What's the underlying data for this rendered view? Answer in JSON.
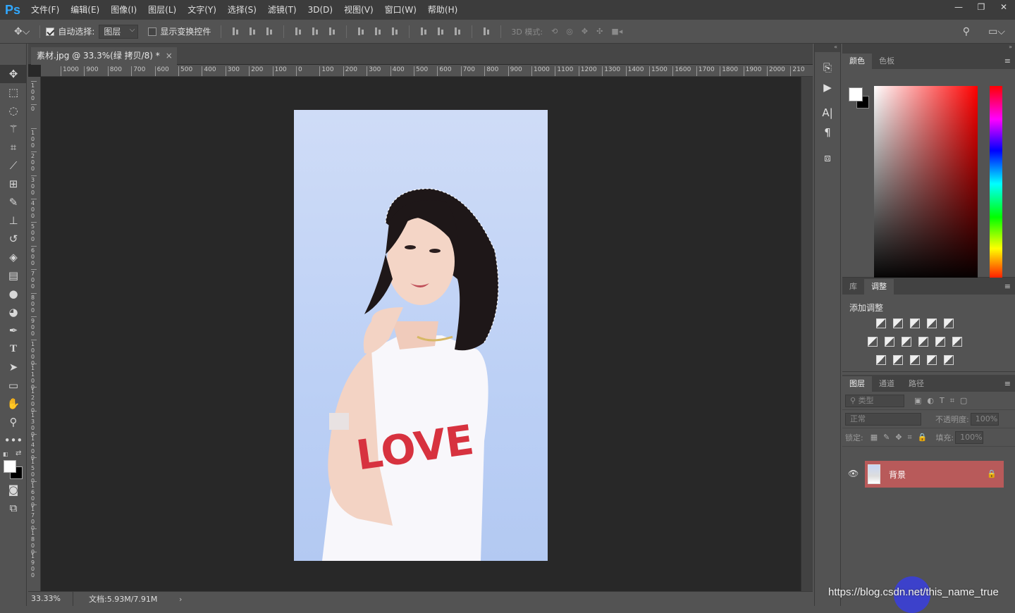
{
  "app": {
    "logo": "Ps"
  },
  "menu": [
    "文件(F)",
    "编辑(E)",
    "图像(I)",
    "图层(L)",
    "文字(Y)",
    "选择(S)",
    "滤镜(T)",
    "3D(D)",
    "视图(V)",
    "窗口(W)",
    "帮助(H)"
  ],
  "window_controls": [
    "—",
    "❐",
    "✕"
  ],
  "options": {
    "auto_select_label": "自动选择:",
    "auto_select_checked": true,
    "auto_select_value": "图层",
    "show_transform_label": "显示变换控件",
    "show_transform_checked": false,
    "mode_3d_label": "3D 模式:"
  },
  "document": {
    "tab_title": "素材.jpg @ 33.3%(绿 拷贝/8) *",
    "close": "×",
    "zoom": "33.33%",
    "doc_info": "文档:5.93M/7.91M",
    "ruler_h": [
      "1000",
      "900",
      "800",
      "700",
      "600",
      "500",
      "400",
      "300",
      "200",
      "100",
      "0",
      "100",
      "200",
      "300",
      "400",
      "500",
      "600",
      "700",
      "800",
      "900",
      "1000",
      "1100",
      "1200",
      "1300",
      "1400",
      "1500",
      "1600",
      "1700",
      "1800",
      "1900",
      "2000",
      "210"
    ],
    "ruler_v": [
      "100",
      "0",
      "100",
      "200",
      "300",
      "400",
      "500",
      "600",
      "700",
      "800",
      "900",
      "1000",
      "1100",
      "1200",
      "1300",
      "1400",
      "1500",
      "1600",
      "1700",
      "1800",
      "1900"
    ],
    "photo_text": "LOVE"
  },
  "color_panel": {
    "tabs": [
      "颜色",
      "色板"
    ],
    "active_tab": 0,
    "fg": "#ffffff",
    "bg": "#000000"
  },
  "adjust_panel": {
    "tabs": [
      "库",
      "调整"
    ],
    "active_tab": 1,
    "title": "添加调整"
  },
  "layers_panel": {
    "tabs": [
      "图层",
      "通道",
      "路径"
    ],
    "active_tab": 0,
    "filter_placeholder": "类型",
    "blend_mode": "正常",
    "opacity_label": "不透明度:",
    "opacity_value": "100%",
    "lock_label": "锁定:",
    "fill_label": "填充:",
    "fill_value": "100%",
    "layers": [
      {
        "name": "背景",
        "locked": true,
        "visible": true
      }
    ]
  },
  "watermark": "https://blog.csdn.net/this_name_true"
}
